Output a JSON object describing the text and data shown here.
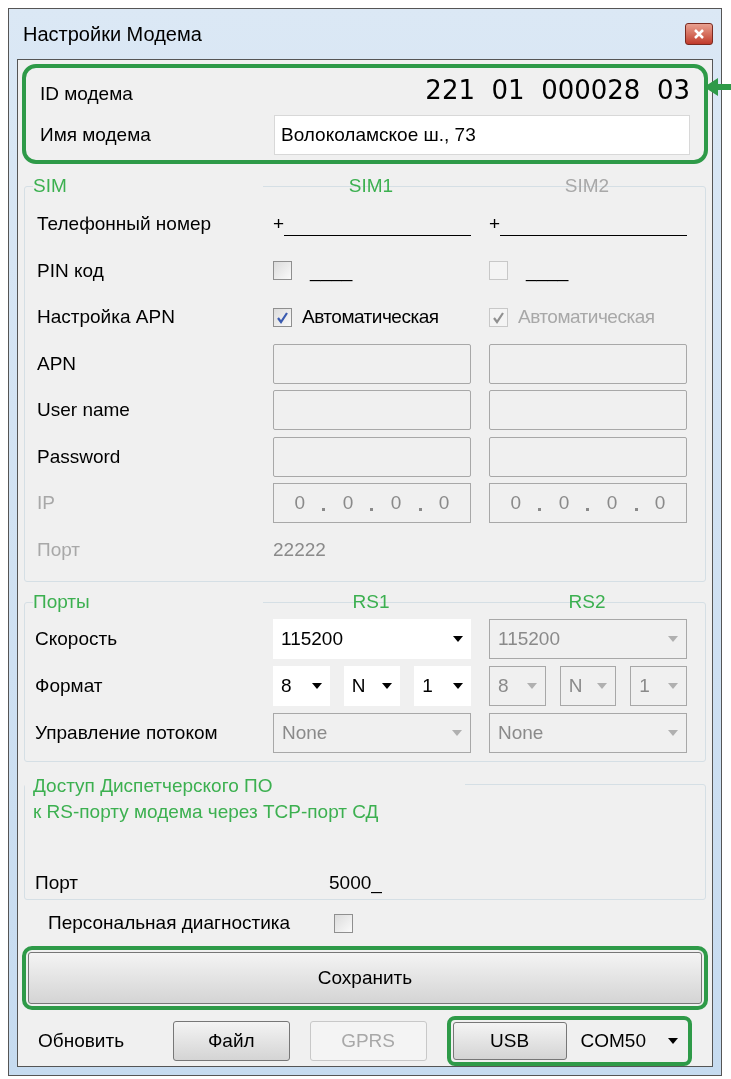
{
  "window": {
    "title": "Настройки Модема"
  },
  "modem": {
    "id_label": "ID модема",
    "id": "221  01  000028  03",
    "name_label": "Имя модема",
    "name": "Волоколамское ш., 73"
  },
  "sim": {
    "title": "SIM",
    "columns": [
      {
        "label": "SIM1",
        "disabled": false
      },
      {
        "label": "SIM2",
        "disabled": true
      }
    ],
    "rows": [
      {
        "kind": "phone",
        "label": "Телефонный номер",
        "disabled": false,
        "cells": [
          {
            "prefix": "+"
          },
          {
            "prefix": "+"
          }
        ]
      },
      {
        "kind": "pin",
        "label": "PIN код",
        "disabled": false,
        "cells": [
          {
            "checked": false,
            "disabled": false,
            "value": "____"
          },
          {
            "checked": false,
            "disabled": true,
            "value": "____"
          }
        ]
      },
      {
        "kind": "checkbox",
        "label": "Настройка APN",
        "disabled": false,
        "cells": [
          {
            "checked": true,
            "disabled": false,
            "text": "Автоматическая"
          },
          {
            "checked": true,
            "disabled": true,
            "text": "Автоматическая"
          }
        ]
      },
      {
        "kind": "input",
        "label": "APN",
        "disabled": false
      },
      {
        "kind": "input",
        "label": "User name",
        "disabled": false
      },
      {
        "kind": "input",
        "label": "Password",
        "disabled": false
      },
      {
        "kind": "ip",
        "label": "IP",
        "disabled": true,
        "cells": [
          {
            "octets": [
              "0",
              "0",
              "0",
              "0"
            ]
          },
          {
            "octets": [
              "0",
              "0",
              "0",
              "0"
            ]
          }
        ]
      },
      {
        "kind": "text",
        "label": "Порт",
        "disabled": true,
        "value": "22222"
      }
    ]
  },
  "ports": {
    "title": "Порты",
    "columns": [
      {
        "label": "RS1"
      },
      {
        "label": "RS2"
      }
    ],
    "rows": [
      {
        "kind": "select",
        "label": "Скорость",
        "cells": [
          [
            {
              "value": "115200",
              "disabled": false
            }
          ],
          [
            {
              "value": "115200",
              "disabled": true
            }
          ]
        ]
      },
      {
        "kind": "format",
        "label": "Формат",
        "cells": [
          [
            {
              "value": "8",
              "disabled": false
            },
            {
              "value": "N",
              "disabled": false
            },
            {
              "value": "1",
              "disabled": false
            }
          ],
          [
            {
              "value": "8",
              "disabled": true
            },
            {
              "value": "N",
              "disabled": true
            },
            {
              "value": "1",
              "disabled": true
            }
          ]
        ]
      },
      {
        "kind": "select",
        "label": "Управление потоком",
        "cells": [
          [
            {
              "value": "None",
              "disabled": true
            }
          ],
          [
            {
              "value": "None",
              "disabled": true
            }
          ]
        ]
      }
    ]
  },
  "access": {
    "title": "Доступ Диспетчерского ПО\nк RS-порту модема через TCP-порт СД",
    "port_label": "Порт",
    "port": "5000_"
  },
  "diagnostics": {
    "label": "Персональная диагностика",
    "checked": false
  },
  "save_button": "Сохранить",
  "footer": {
    "refresh_label": "Обновить",
    "buttons": [
      {
        "label": "Файл",
        "disabled": false
      },
      {
        "label": "GPRS",
        "disabled": true
      },
      {
        "label": "USB",
        "disabled": false
      }
    ],
    "port": {
      "value": "COM50"
    }
  }
}
